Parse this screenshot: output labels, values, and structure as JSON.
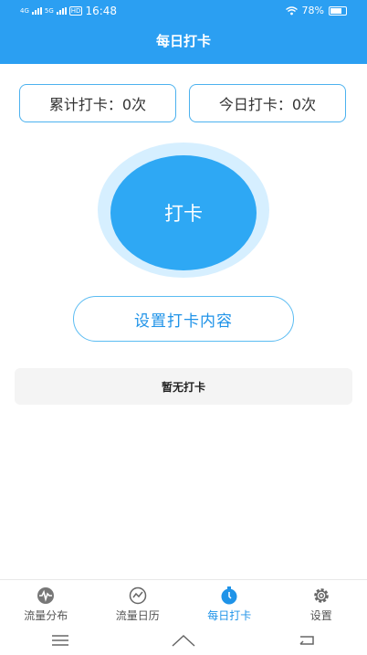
{
  "status_bar": {
    "network_left": "4G",
    "network_right": "5G",
    "hd": "HD",
    "time": "16:48",
    "battery": "78%"
  },
  "header": {
    "title": "每日打卡"
  },
  "stats": {
    "total": "累计打卡：0次",
    "today": "今日打卡：0次"
  },
  "punch_button": {
    "label": "打卡"
  },
  "set_content_button": {
    "label": "设置打卡内容"
  },
  "empty_state": {
    "text": "暂无打卡"
  },
  "tabs": [
    {
      "label": "流量分布",
      "icon": "pulse-icon"
    },
    {
      "label": "流量日历",
      "icon": "trend-icon"
    },
    {
      "label": "每日打卡",
      "icon": "clock-icon",
      "active": true
    },
    {
      "label": "设置",
      "icon": "gear-icon"
    }
  ],
  "colors": {
    "accent": "#2b9ff2",
    "active_tab": "#1f93e8"
  }
}
